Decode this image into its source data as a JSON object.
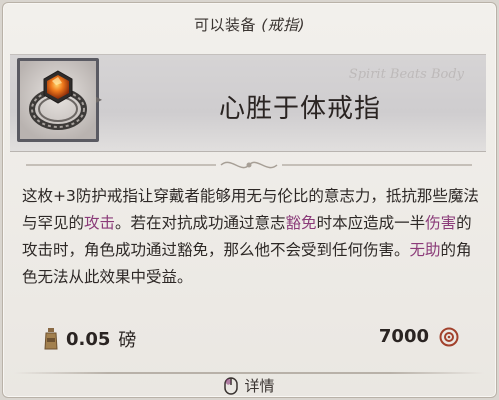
{
  "header": {
    "equip_label": "可以装备",
    "equip_slot": "(戒指)"
  },
  "item": {
    "name": "心胜于体戒指",
    "icon": "ring-with-orange-gem-icon",
    "watermark": "Spirit Beats Body"
  },
  "description": {
    "part1": "这枚+3防护戒指让穿戴者能够用无与伦比的意志力，抵抗那些魔法与罕见的",
    "kw_attack": "攻击",
    "part2": "。若在对抗成功通过意志",
    "kw_immune": "豁免",
    "part3": "时本应造成一半",
    "kw_damage": "伤害",
    "part4": "的攻击时，角色成功通过豁免，那么他不会受到任何伤害。",
    "kw_helpless": "无助",
    "part5": "的角色无法从此效果中受益。"
  },
  "stats": {
    "weight_value": "0.05",
    "weight_unit": "磅",
    "weight_icon": "weight-icon",
    "price_value": "7000",
    "price_icon": "coin-icon"
  },
  "footer": {
    "details_label": "详情",
    "details_icon": "mouse-icon"
  },
  "colors": {
    "keyword": "#8b3b79",
    "text": "#2d2826",
    "background": "#eeebe6"
  }
}
